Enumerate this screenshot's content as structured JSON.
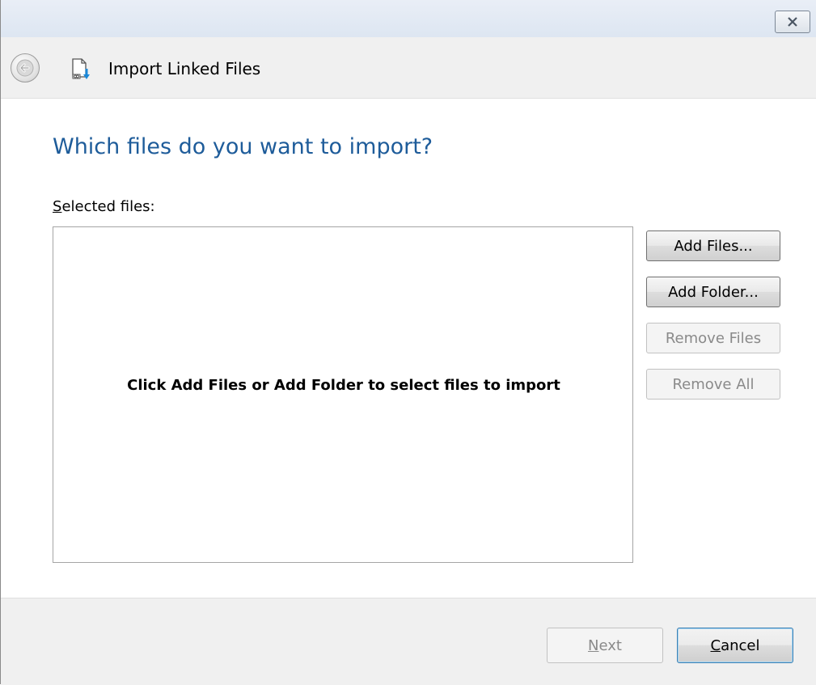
{
  "window": {
    "close_icon": "close-x-icon"
  },
  "header": {
    "back_icon": "back-arrow-icon",
    "app_icon": "import-linked-files-icon",
    "title": "Import Linked Files"
  },
  "main": {
    "heading": "Which files do you want to import?",
    "selected_files_label_mnemonic": "S",
    "selected_files_label_rest": "elected files:",
    "empty_message": "Click Add Files or Add Folder to select files to import"
  },
  "side_buttons": {
    "add_files": "Add Files...",
    "add_folder": "Add Folder...",
    "remove_files": "Remove Files",
    "remove_all": "Remove All"
  },
  "footer": {
    "next_mnemonic": "N",
    "next_rest": "ext",
    "cancel_mnemonic": "C",
    "cancel_rest": "ancel"
  },
  "colors": {
    "heading": "#1e5c9a",
    "disabled_text": "#8a8a8a"
  }
}
